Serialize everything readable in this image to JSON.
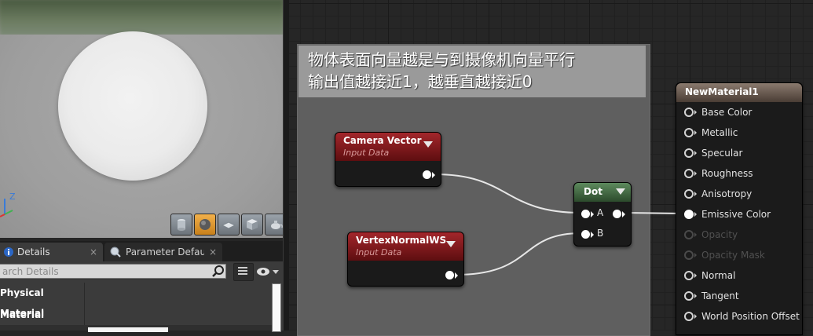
{
  "viewport": {
    "axis": {
      "z_label": "Z"
    },
    "toolbar": [
      {
        "icon": "cylinder-icon",
        "active": false
      },
      {
        "icon": "sphere-icon",
        "active": true
      },
      {
        "icon": "plane-icon",
        "active": false
      },
      {
        "icon": "cube-icon",
        "active": false
      },
      {
        "icon": "teapot-icon",
        "active": false
      }
    ]
  },
  "graph": {
    "comment": {
      "line1": "物体表面向量越是与到摄像机向量平行",
      "line2": "输出值越接近1，越垂直越接近0"
    },
    "nodes": {
      "camera_vector": {
        "title": "Camera Vector",
        "subtitle": "Input Data"
      },
      "vertex_normal": {
        "title": "VertexNormalWS",
        "subtitle": "Input Data"
      },
      "dot": {
        "title": "Dot",
        "input_a": "A",
        "input_b": "B"
      }
    },
    "material": {
      "title": "NewMaterial1",
      "inputs": [
        {
          "label": "Base Color",
          "enabled": true,
          "connected": false
        },
        {
          "label": "Metallic",
          "enabled": true,
          "connected": false
        },
        {
          "label": "Specular",
          "enabled": true,
          "connected": false
        },
        {
          "label": "Roughness",
          "enabled": true,
          "connected": false
        },
        {
          "label": "Anisotropy",
          "enabled": true,
          "connected": false
        },
        {
          "label": "Emissive Color",
          "enabled": true,
          "connected": true
        },
        {
          "label": "Opacity",
          "enabled": false,
          "connected": false
        },
        {
          "label": "Opacity Mask",
          "enabled": false,
          "connected": false
        },
        {
          "label": "Normal",
          "enabled": true,
          "connected": false
        },
        {
          "label": "Tangent",
          "enabled": true,
          "connected": false
        },
        {
          "label": "World Position Offset",
          "enabled": true,
          "connected": false
        }
      ]
    }
  },
  "panel": {
    "tabs": [
      {
        "label": "Details",
        "close": "×"
      },
      {
        "label": "Parameter Defaults",
        "close": "×"
      }
    ],
    "search": {
      "placeholder": "arch Details"
    },
    "categories": [
      "Physical Material",
      "Material"
    ]
  },
  "colors": {
    "graph_bg": "#262626",
    "comment_title_bg": "#9a9a9a",
    "input_node_header": "#a3262b",
    "dot_node_header": "#5d8a5d",
    "result_header": "#8a7a6e",
    "active_toolbar": "#f2b04a"
  }
}
